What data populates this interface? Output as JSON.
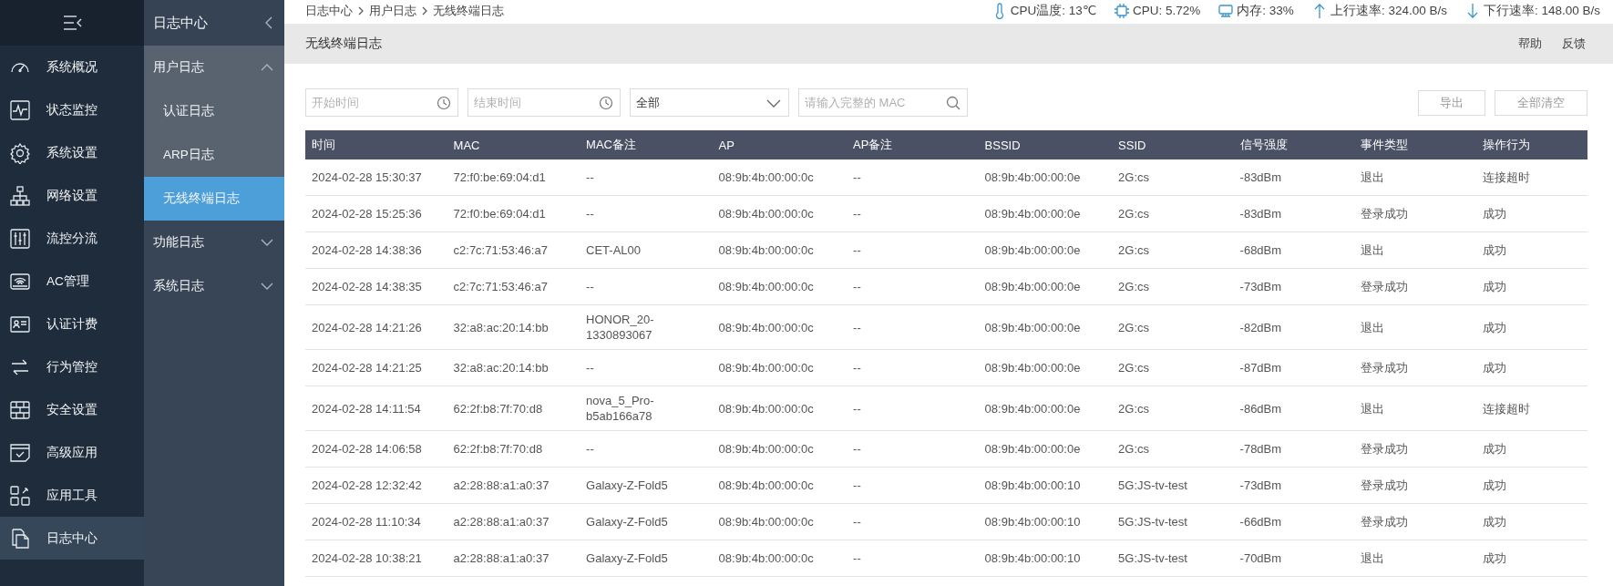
{
  "nav": {
    "items": [
      {
        "label": "系统概况",
        "selected": false
      },
      {
        "label": "状态监控",
        "selected": false
      },
      {
        "label": "系统设置",
        "selected": false
      },
      {
        "label": "网络设置",
        "selected": false
      },
      {
        "label": "流控分流",
        "selected": false
      },
      {
        "label": "AC管理",
        "selected": false
      },
      {
        "label": "认证计费",
        "selected": false
      },
      {
        "label": "行为管控",
        "selected": false
      },
      {
        "label": "安全设置",
        "selected": false
      },
      {
        "label": "高级应用",
        "selected": false
      },
      {
        "label": "应用工具",
        "selected": false
      },
      {
        "label": "日志中心",
        "selected": true
      }
    ]
  },
  "submenu": {
    "title": "日志中心",
    "groups": [
      {
        "label": "用户日志",
        "expanded": true,
        "children": [
          {
            "label": "认证日志",
            "selected": false
          },
          {
            "label": "ARP日志",
            "selected": false
          },
          {
            "label": "无线终端日志",
            "selected": true
          }
        ]
      },
      {
        "label": "功能日志",
        "expanded": false
      },
      {
        "label": "系统日志",
        "expanded": false
      }
    ]
  },
  "breadcrumb": [
    "日志中心",
    "用户日志",
    "无线终端日志"
  ],
  "stats": [
    {
      "label": "CPU温度: 13℃"
    },
    {
      "label": "CPU: 5.72%"
    },
    {
      "label": "内存: 33%"
    },
    {
      "label": "上行速率: 324.00 B/s"
    },
    {
      "label": "下行速率: 148.00 B/s"
    }
  ],
  "page_title": "无线终端日志",
  "header_links": [
    "帮助",
    "反馈"
  ],
  "filters": {
    "start_time": {
      "placeholder": "开始时间"
    },
    "end_time": {
      "placeholder": "结束时间"
    },
    "type_select": {
      "value": "全部"
    },
    "mac_search": {
      "placeholder": "请输入完整的 MAC"
    }
  },
  "actions": [
    "导出",
    "全部清空"
  ],
  "table": {
    "columns": [
      "时间",
      "MAC",
      "MAC备注",
      "AP",
      "AP备注",
      "BSSID",
      "SSID",
      "信号强度",
      "事件类型",
      "操作行为"
    ],
    "rows": [
      [
        "2024-02-28 15:30:37",
        "72:f0:be:69:04:d1",
        "--",
        "08:9b:4b:00:00:0c",
        "--",
        "08:9b:4b:00:00:0e",
        "2G:cs",
        "-83dBm",
        "退出",
        "连接超时"
      ],
      [
        "2024-02-28 15:25:36",
        "72:f0:be:69:04:d1",
        "--",
        "08:9b:4b:00:00:0c",
        "--",
        "08:9b:4b:00:00:0e",
        "2G:cs",
        "-83dBm",
        "登录成功",
        "成功"
      ],
      [
        "2024-02-28 14:38:36",
        "c2:7c:71:53:46:a7",
        "CET-AL00",
        "08:9b:4b:00:00:0c",
        "--",
        "08:9b:4b:00:00:0e",
        "2G:cs",
        "-68dBm",
        "退出",
        "成功"
      ],
      [
        "2024-02-28 14:38:35",
        "c2:7c:71:53:46:a7",
        "--",
        "08:9b:4b:00:00:0c",
        "--",
        "08:9b:4b:00:00:0e",
        "2G:cs",
        "-73dBm",
        "登录成功",
        "成功"
      ],
      [
        "2024-02-28 14:21:26",
        "32:a8:ac:20:14:bb",
        "HONOR_20-1330893067",
        "08:9b:4b:00:00:0c",
        "--",
        "08:9b:4b:00:00:0e",
        "2G:cs",
        "-82dBm",
        "退出",
        "成功"
      ],
      [
        "2024-02-28 14:21:25",
        "32:a8:ac:20:14:bb",
        "--",
        "08:9b:4b:00:00:0c",
        "--",
        "08:9b:4b:00:00:0e",
        "2G:cs",
        "-87dBm",
        "登录成功",
        "成功"
      ],
      [
        "2024-02-28 14:11:54",
        "62:2f:b8:7f:70:d8",
        "nova_5_Pro-b5ab166a78",
        "08:9b:4b:00:00:0c",
        "--",
        "08:9b:4b:00:00:0e",
        "2G:cs",
        "-86dBm",
        "退出",
        "连接超时"
      ],
      [
        "2024-02-28 14:06:58",
        "62:2f:b8:7f:70:d8",
        "--",
        "08:9b:4b:00:00:0c",
        "--",
        "08:9b:4b:00:00:0e",
        "2G:cs",
        "-78dBm",
        "登录成功",
        "成功"
      ],
      [
        "2024-02-28 12:32:42",
        "a2:28:88:a1:a0:37",
        "Galaxy-Z-Fold5",
        "08:9b:4b:00:00:0c",
        "--",
        "08:9b:4b:00:00:10",
        "5G:JS-tv-test",
        "-73dBm",
        "登录成功",
        "成功"
      ],
      [
        "2024-02-28 11:10:34",
        "a2:28:88:a1:a0:37",
        "Galaxy-Z-Fold5",
        "08:9b:4b:00:00:0c",
        "--",
        "08:9b:4b:00:00:10",
        "5G:JS-tv-test",
        "-66dBm",
        "登录成功",
        "成功"
      ],
      [
        "2024-02-28 10:38:21",
        "a2:28:88:a1:a0:37",
        "Galaxy-Z-Fold5",
        "08:9b:4b:00:00:0c",
        "--",
        "08:9b:4b:00:00:10",
        "5G:JS-tv-test",
        "-70dBm",
        "退出",
        "成功"
      ]
    ]
  }
}
